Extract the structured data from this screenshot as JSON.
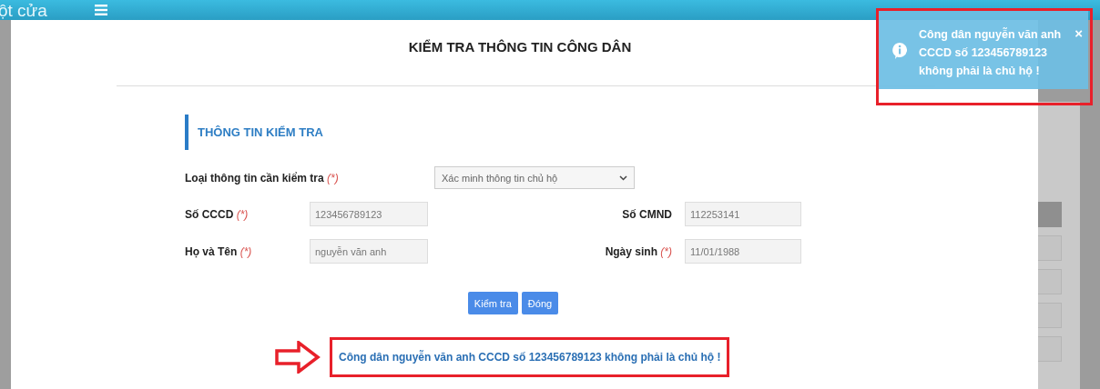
{
  "header": {
    "app_title": "ột cửa"
  },
  "modal": {
    "title": "KIỂM TRA THÔNG TIN CÔNG DÂN",
    "section_title": "THÔNG TIN KIỂM TRA",
    "check_type": {
      "label": "Loại thông tin cần kiểm tra",
      "required_mark": "(*)",
      "value": "Xác minh thông tin chủ hộ"
    },
    "fields": [
      {
        "label": "Số CCCD",
        "required_mark": "(*)",
        "value": "123456789123"
      },
      {
        "label": "Số CMND",
        "value": "112253141"
      },
      {
        "label": "Họ và Tên",
        "required_mark": "(*)",
        "value": "nguyễn văn anh"
      },
      {
        "label": "Ngày sinh",
        "required_mark": "(*)",
        "value": "11/01/1988"
      }
    ],
    "buttons": [
      "Kiểm tra",
      "Đóng"
    ],
    "result_message": "Công dân nguyễn văn anh CCCD số 123456789123 không phải là chủ hộ !"
  },
  "toast": {
    "message": "Công dân nguyễn văn anh CCCD số 123456789123 không phải là chủ hộ !",
    "close": "×"
  }
}
